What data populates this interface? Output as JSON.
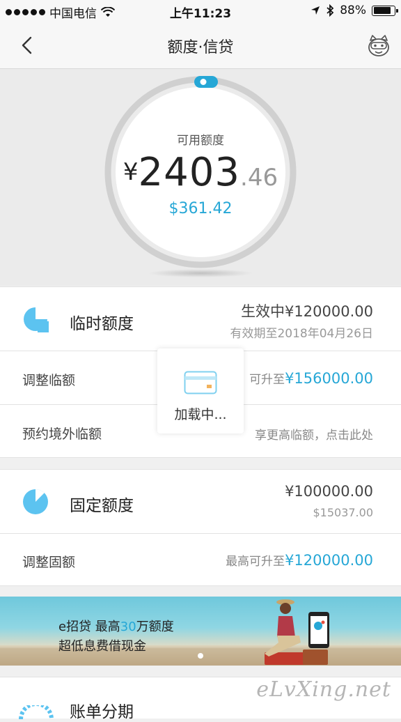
{
  "status_bar": {
    "carrier": "中国电信",
    "time": "上午11:23",
    "battery": "88%",
    "battery_level": 0.88
  },
  "nav": {
    "title": "额度·信贷",
    "back_icon": "chevron-left-icon",
    "service_icon": "mascot-icon"
  },
  "available": {
    "label": "可用额度",
    "currency": "¥",
    "integer": "2403",
    "decimal": ".46",
    "usd": "$361.42"
  },
  "temporary": {
    "name": "临时额度",
    "status": "生效中¥120000.00",
    "validity": "有效期至2018年04月26日",
    "adjust_label": "调整临额",
    "adjust_prefix": "可升至",
    "adjust_value": "¥156000.00",
    "overseas_label": "预约境外临额",
    "overseas_hint": "享更高临额，点击此处"
  },
  "loading": {
    "text": "加载中..."
  },
  "fixed": {
    "name": "固定额度",
    "cny": "¥100000.00",
    "usd": "$15037.00",
    "adjust_label": "调整固额",
    "adjust_prefix": "最高可升至",
    "adjust_value": "¥120000.00"
  },
  "banner": {
    "line1_a": "e招贷  最高",
    "line1_b": "30",
    "line1_c": "万额度",
    "line2": "超低息费借现金"
  },
  "installment": {
    "name": "账单分期"
  },
  "watermark": "eLvXing.net",
  "colors": {
    "accent": "#26a7d6",
    "icon_blue": "#5cc3f0"
  }
}
